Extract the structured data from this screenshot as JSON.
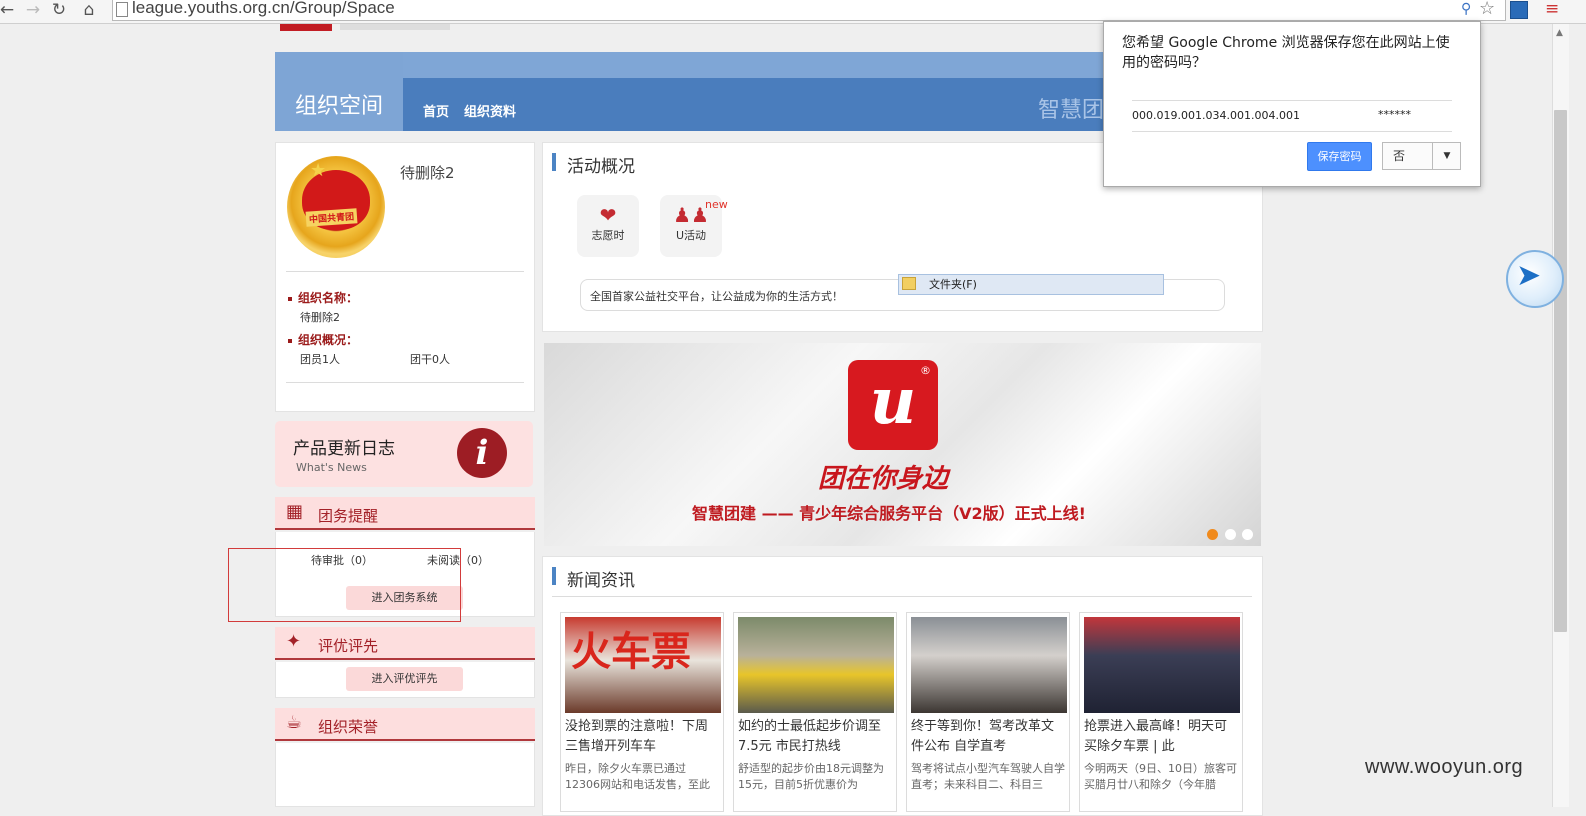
{
  "browser": {
    "url": "league.youths.org.cn/Group/Space"
  },
  "header": {
    "title": "组织空间",
    "nav": [
      "首页",
      "组织资料"
    ],
    "right_text": "智慧团"
  },
  "profile": {
    "name": "待删除2",
    "org_name_label": "组织名称：",
    "org_name_value": "待删除2",
    "overview_label": "组织概况：",
    "members": "团员1人",
    "cadres": "团干0人",
    "emblem_text": "中国共青团"
  },
  "changelog": {
    "title": "产品更新日志",
    "subtitle": "What's News"
  },
  "league_tasks": {
    "title": "团务提醒",
    "pending": "待审批（0）",
    "unread": "未阅读（0）",
    "button": "进入团务系统"
  },
  "awards": {
    "title": "评优评先",
    "button": "进入评优评先"
  },
  "honors": {
    "title": "组织荣誉"
  },
  "activity": {
    "title": "活动概况",
    "cards": [
      {
        "label": "志愿时"
      },
      {
        "label": "U活动"
      }
    ],
    "new_badge": "new",
    "slogan": "全国首家公益社交平台，让公益成为你的生活方式！"
  },
  "folder_tooltip": "文件夹(F)",
  "banner": {
    "slogan": "团在你身边",
    "caption": "智慧团建 —— 青少年综合服务平台（V2版）正式上线!"
  },
  "news": {
    "title": "新闻资讯",
    "items": [
      {
        "title": "没抢到票的注意啦！下周三售增开列车车",
        "desc": "昨日，除夕火车票已通过12306网站和电话发售，至此",
        "img_text": "火车票"
      },
      {
        "title": "如约的士最低起步价调至7.5元 市民打热线",
        "desc": "舒适型的起步价由18元调整为15元，目前5折优惠价为"
      },
      {
        "title": "终于等到你！驾考改革文件公布 自学直考",
        "desc": "驾考将试点小型汽车驾驶人自学直考；未来科目二、科目三"
      },
      {
        "title": "抢票进入最高峰！明天可买除夕车票 | 此",
        "desc": "今明两天（9日、10日）旅客可买腊月廿八和除夕（今年腊"
      }
    ]
  },
  "password_popup": {
    "message": "您希望 Google Chrome 浏览器保存您在此网站上使用的密码吗？",
    "username": "000.019.001.034.001.004.001",
    "password": "******",
    "save_button": "保存密码",
    "no_button": "否"
  },
  "watermark": "www.wooyun.org",
  "colors": {
    "header_blue": "#4a7dbd",
    "accent_red": "#a32128",
    "chrome_blue": "#4d90fe"
  }
}
